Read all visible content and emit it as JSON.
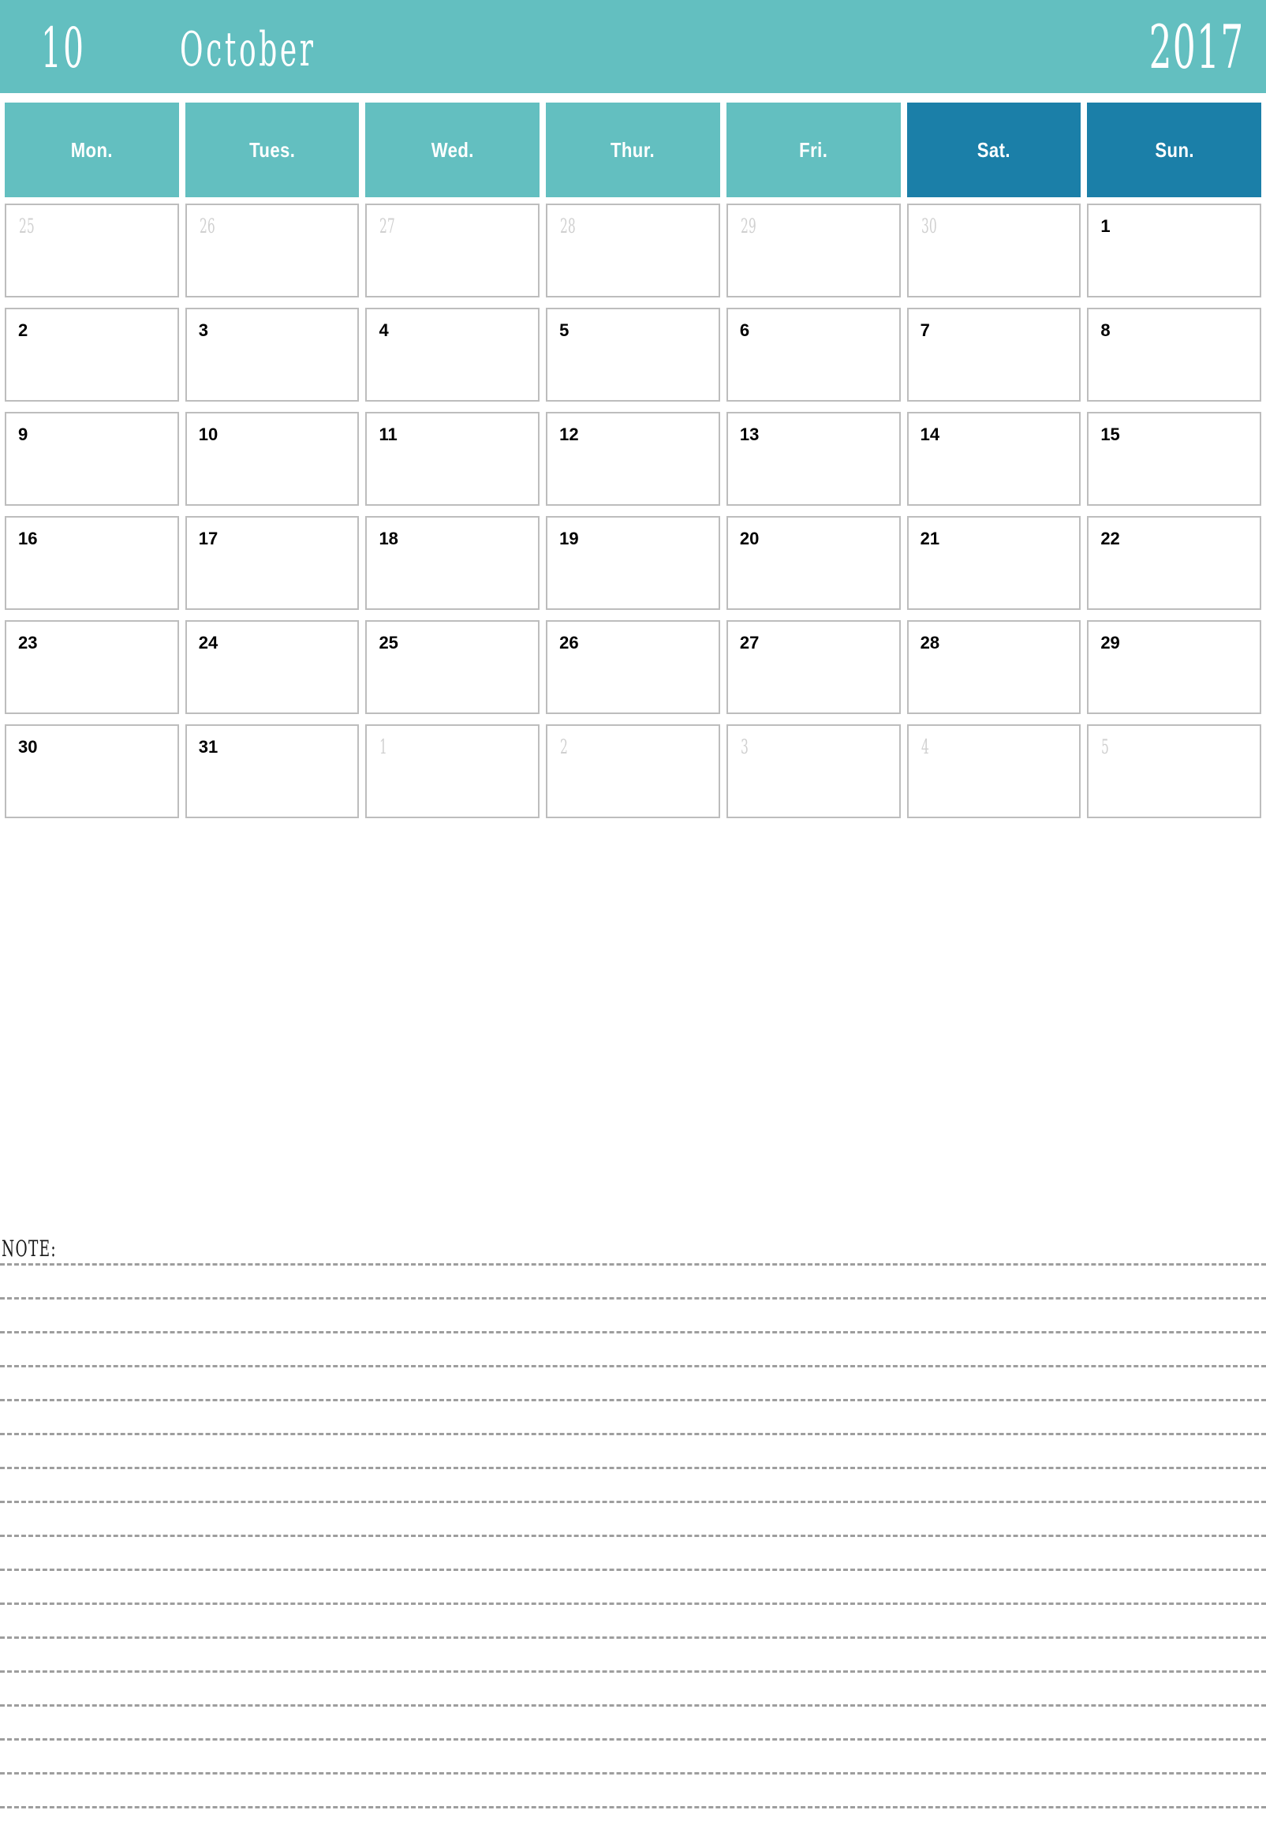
{
  "header": {
    "month_number": "10",
    "month_name": "October",
    "year": "2017",
    "background_color": "#63bfc0",
    "text_color": "#ffffff"
  },
  "weekdays": [
    {
      "label": "Mon.",
      "weekend": false,
      "color": "#63bfc0"
    },
    {
      "label": "Tues.",
      "weekend": false,
      "color": "#63bfc0"
    },
    {
      "label": "Wed.",
      "weekend": false,
      "color": "#63bfc0"
    },
    {
      "label": "Thur.",
      "weekend": false,
      "color": "#63bfc0"
    },
    {
      "label": "Fri.",
      "weekend": false,
      "color": "#63bfc0"
    },
    {
      "label": "Sat.",
      "weekend": true,
      "color": "#1b7fa8"
    },
    {
      "label": "Sun.",
      "weekend": true,
      "color": "#1b7fa8"
    }
  ],
  "grid": {
    "rows": [
      [
        {
          "day": "25",
          "current_month": false
        },
        {
          "day": "26",
          "current_month": false
        },
        {
          "day": "27",
          "current_month": false
        },
        {
          "day": "28",
          "current_month": false
        },
        {
          "day": "29",
          "current_month": false
        },
        {
          "day": "30",
          "current_month": false
        },
        {
          "day": "1",
          "current_month": true
        }
      ],
      [
        {
          "day": "2",
          "current_month": true
        },
        {
          "day": "3",
          "current_month": true
        },
        {
          "day": "4",
          "current_month": true
        },
        {
          "day": "5",
          "current_month": true
        },
        {
          "day": "6",
          "current_month": true
        },
        {
          "day": "7",
          "current_month": true
        },
        {
          "day": "8",
          "current_month": true
        }
      ],
      [
        {
          "day": "9",
          "current_month": true
        },
        {
          "day": "10",
          "current_month": true
        },
        {
          "day": "11",
          "current_month": true
        },
        {
          "day": "12",
          "current_month": true
        },
        {
          "day": "13",
          "current_month": true
        },
        {
          "day": "14",
          "current_month": true
        },
        {
          "day": "15",
          "current_month": true
        }
      ],
      [
        {
          "day": "16",
          "current_month": true
        },
        {
          "day": "17",
          "current_month": true
        },
        {
          "day": "18",
          "current_month": true
        },
        {
          "day": "19",
          "current_month": true
        },
        {
          "day": "20",
          "current_month": true
        },
        {
          "day": "21",
          "current_month": true
        },
        {
          "day": "22",
          "current_month": true
        }
      ],
      [
        {
          "day": "23",
          "current_month": true
        },
        {
          "day": "24",
          "current_month": true
        },
        {
          "day": "25",
          "current_month": true
        },
        {
          "day": "26",
          "current_month": true
        },
        {
          "day": "27",
          "current_month": true
        },
        {
          "day": "28",
          "current_month": true
        },
        {
          "day": "29",
          "current_month": true
        }
      ],
      [
        {
          "day": "30",
          "current_month": true
        },
        {
          "day": "31",
          "current_month": true
        },
        {
          "day": "1",
          "current_month": false
        },
        {
          "day": "2",
          "current_month": false
        },
        {
          "day": "3",
          "current_month": false
        },
        {
          "day": "4",
          "current_month": false
        },
        {
          "day": "5",
          "current_month": false
        }
      ]
    ],
    "cell_border_color": "#bdbdbd",
    "current_month_text_color": "#000000",
    "adjacent_month_text_color": "#d0d0d0"
  },
  "note": {
    "label": "NOTE:",
    "line_count": 17,
    "line_color": "#9e9e9e"
  }
}
